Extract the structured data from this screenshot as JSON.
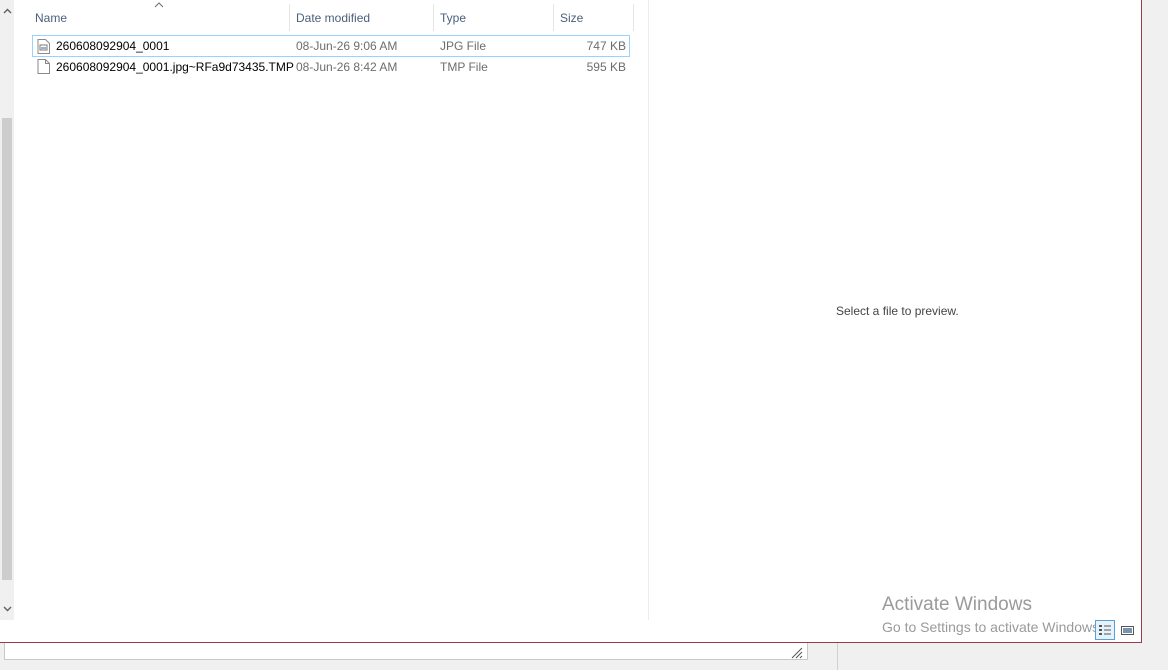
{
  "columns": {
    "name": "Name",
    "date_modified": "Date modified",
    "type": "Type",
    "size": "Size"
  },
  "files": [
    {
      "name": "260608092904_0001",
      "date": "08-Jun-26 9:06 AM",
      "type": "JPG File",
      "size": "747 KB",
      "icon": "image-file-icon",
      "selected": true
    },
    {
      "name": "260608092904_0001.jpg~RFa9d73435.TMP",
      "date": "08-Jun-26 8:42 AM",
      "type": "TMP File",
      "size": "595 KB",
      "icon": "blank-file-icon",
      "selected": false
    }
  ],
  "preview": {
    "message": "Select a file to preview."
  },
  "watermark": {
    "title": "Activate Windows",
    "subtitle": "Go to Settings to activate Windows."
  },
  "colors": {
    "header_text": "#4c607a",
    "selection_border": "#99d1ff",
    "window_border": "#9b3a4a"
  }
}
